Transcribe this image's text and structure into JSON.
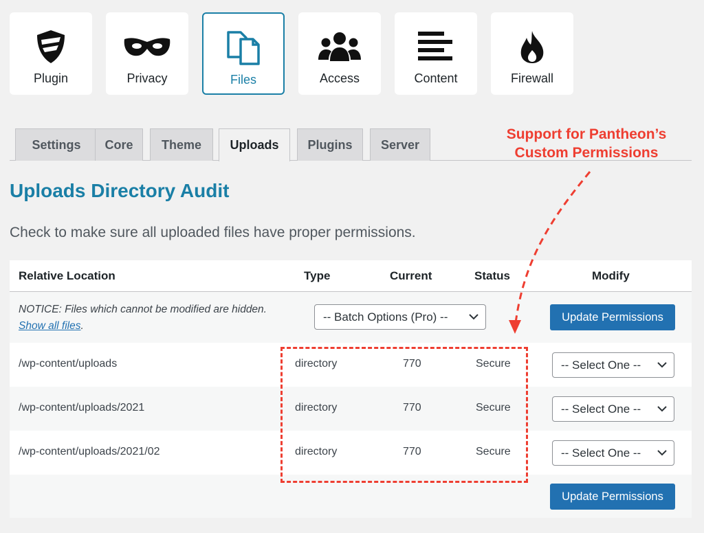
{
  "cards": [
    {
      "label": "Plugin",
      "icon": "shield-icon"
    },
    {
      "label": "Privacy",
      "icon": "mask-icon"
    },
    {
      "label": "Files",
      "icon": "files-icon",
      "active": true
    },
    {
      "label": "Access",
      "icon": "users-icon"
    },
    {
      "label": "Content",
      "icon": "align-left-icon"
    },
    {
      "label": "Firewall",
      "icon": "fire-icon"
    }
  ],
  "tabs": [
    {
      "label": "Settings"
    },
    {
      "label": "Core"
    },
    {
      "label": "Theme"
    },
    {
      "label": "Uploads",
      "active": true
    },
    {
      "label": "Plugins"
    },
    {
      "label": "Server"
    }
  ],
  "page": {
    "title": "Uploads Directory Audit",
    "description": "Check to make sure all uploaded files have proper permissions."
  },
  "table": {
    "headers": {
      "location": "Relative Location",
      "type": "Type",
      "current": "Current",
      "status": "Status",
      "modify": "Modify"
    },
    "notice_text": "NOTICE: Files which cannot be modified are hidden.",
    "notice_link": "Show all files",
    "notice_end": ".",
    "batch_select": "-- Batch Options (Pro) --",
    "update_button": "Update Permissions",
    "rows": [
      {
        "location": "/wp-content/uploads",
        "type": "directory",
        "current": "770",
        "status": "Secure",
        "modify": "-- Select One --"
      },
      {
        "location": "/wp-content/uploads/2021",
        "type": "directory",
        "current": "770",
        "status": "Secure",
        "modify": "-- Select One --"
      },
      {
        "location": "/wp-content/uploads/2021/02",
        "type": "directory",
        "current": "770",
        "status": "Secure",
        "modify": "-- Select One --"
      }
    ]
  },
  "annotation": {
    "line1": "Support for Pantheon’s",
    "line2": "Custom Permissions",
    "color": "#ee3e31"
  },
  "colors": {
    "accent": "#1a7fa6",
    "button": "#2271b1"
  }
}
